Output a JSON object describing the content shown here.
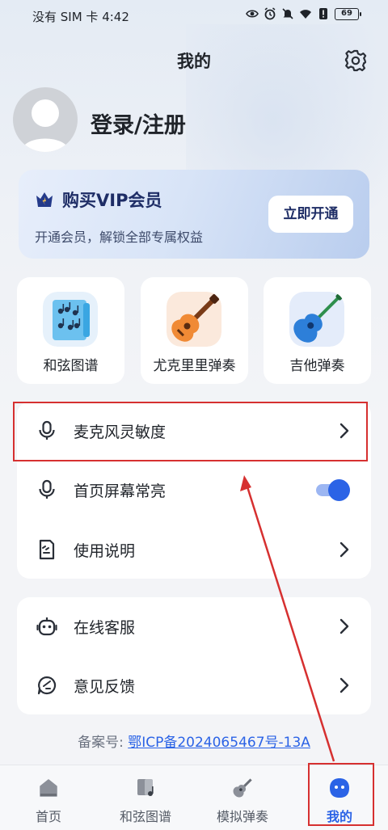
{
  "status_bar": {
    "carrier_time": "没有 SIM 卡 4:42",
    "battery": "69"
  },
  "header": {
    "title": "我的"
  },
  "profile": {
    "login": "登录/注册"
  },
  "vip": {
    "title": "购买VIP会员",
    "subtitle": "开通会员，解锁全部专属权益",
    "button": "立即开通"
  },
  "features": [
    {
      "label": "和弦图谱",
      "icon": "chord-chart-icon"
    },
    {
      "label": "尤克里里弹奏",
      "icon": "ukulele-icon"
    },
    {
      "label": "吉他弹奏",
      "icon": "guitar-icon"
    }
  ],
  "settings_group1": [
    {
      "label": "麦克风灵敏度",
      "icon": "microphone-icon",
      "control": "chevron"
    },
    {
      "label": "首页屏幕常亮",
      "icon": "microphone-icon",
      "control": "toggle",
      "value": true
    },
    {
      "label": "使用说明",
      "icon": "document-icon",
      "control": "chevron"
    }
  ],
  "settings_group2": [
    {
      "label": "在线客服",
      "icon": "robot-icon",
      "control": "chevron"
    },
    {
      "label": "意见反馈",
      "icon": "feedback-icon",
      "control": "chevron"
    }
  ],
  "record": {
    "prefix": "备案号:",
    "link": "鄂ICP备2024065467号-13A"
  },
  "bottom_nav": [
    {
      "label": "首页",
      "icon": "home-icon"
    },
    {
      "label": "和弦图谱",
      "icon": "chord-chart-icon"
    },
    {
      "label": "模拟弹奏",
      "icon": "guitar-icon"
    },
    {
      "label": "我的",
      "icon": "profile-icon",
      "active": true
    }
  ],
  "colors": {
    "accent": "#2b63e6",
    "highlight": "#d63030",
    "vip_text": "#1e2d66"
  }
}
